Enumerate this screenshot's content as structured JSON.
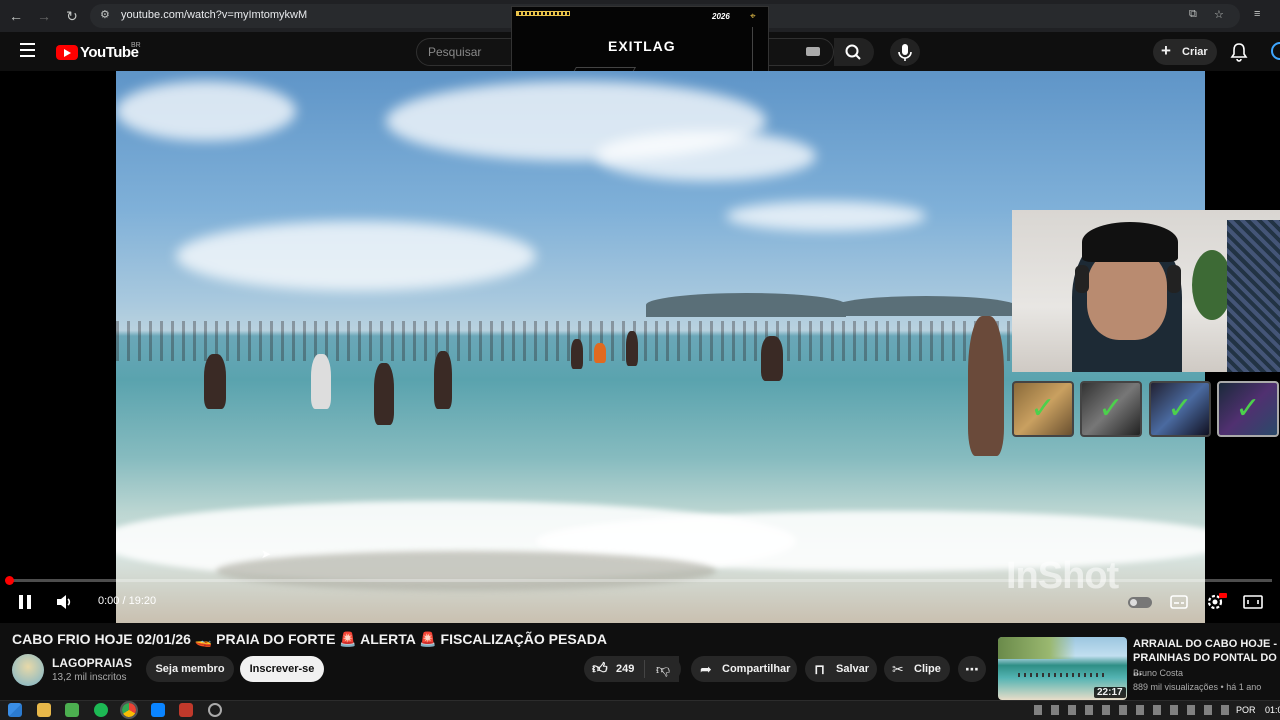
{
  "browser": {
    "url": "youtube.com/watch?v=myImtomykwM"
  },
  "header": {
    "logo": "YouTube",
    "region": "BR",
    "search_placeholder": "Pesquisar",
    "create_label": "Criar"
  },
  "overlay": {
    "exitlag_logo": "EXITLAG",
    "exitlag_year": "2026"
  },
  "player": {
    "time": "0:00 / 19:20",
    "watermark": "InShot",
    "progress_fraction": 0.0
  },
  "video": {
    "title": "CABO FRIO HOJE 02/01/26 🚤 PRAIA DO FORTE 🚨 ALERTA 🚨 FISCALIZAÇÃO PESADA",
    "channel": "LAGOPRAIAS",
    "subscribers": "13,2 mil inscritos",
    "member_label": "Seja membro",
    "subscribe_label": "Inscrever-se",
    "likes": "249",
    "share_label": "Compartilhar",
    "save_label": "Salvar",
    "clip_label": "Clipe"
  },
  "recommended": {
    "title": "ARRAIAL DO CABO HOJE - PRAINHAS DO PONTAL DO ...",
    "channel": "Bruno Costa",
    "meta": "889 mil visualizações • há 1 ano",
    "duration": "22:17"
  },
  "taskbar": {
    "language": "POR",
    "clock": "01:0"
  }
}
